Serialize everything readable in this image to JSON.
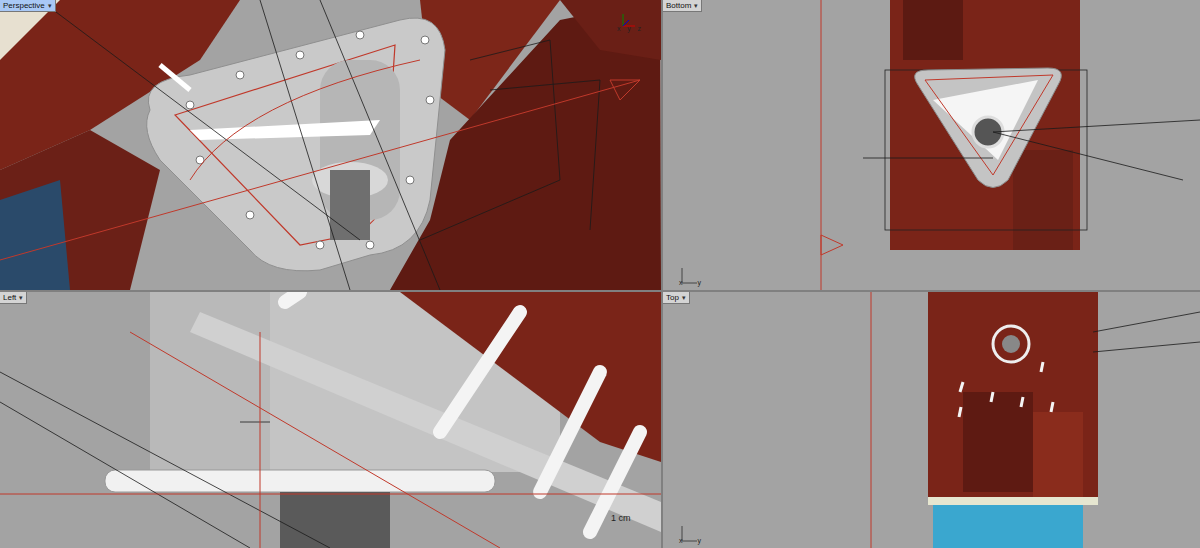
{
  "viewports": [
    {
      "title": "Perspective",
      "dropdown": "▾",
      "selected": true,
      "axes": [
        "x",
        "y",
        "z"
      ]
    },
    {
      "title": "Bottom",
      "dropdown": "▾",
      "selected": false,
      "axes": [
        "x",
        "y"
      ]
    },
    {
      "title": "Left",
      "dropdown": "▾",
      "selected": false,
      "axes": []
    },
    {
      "title": "Top",
      "dropdown": "▾",
      "selected": false,
      "axes": [
        "x",
        "y"
      ]
    }
  ],
  "scale_label": "1 cm"
}
